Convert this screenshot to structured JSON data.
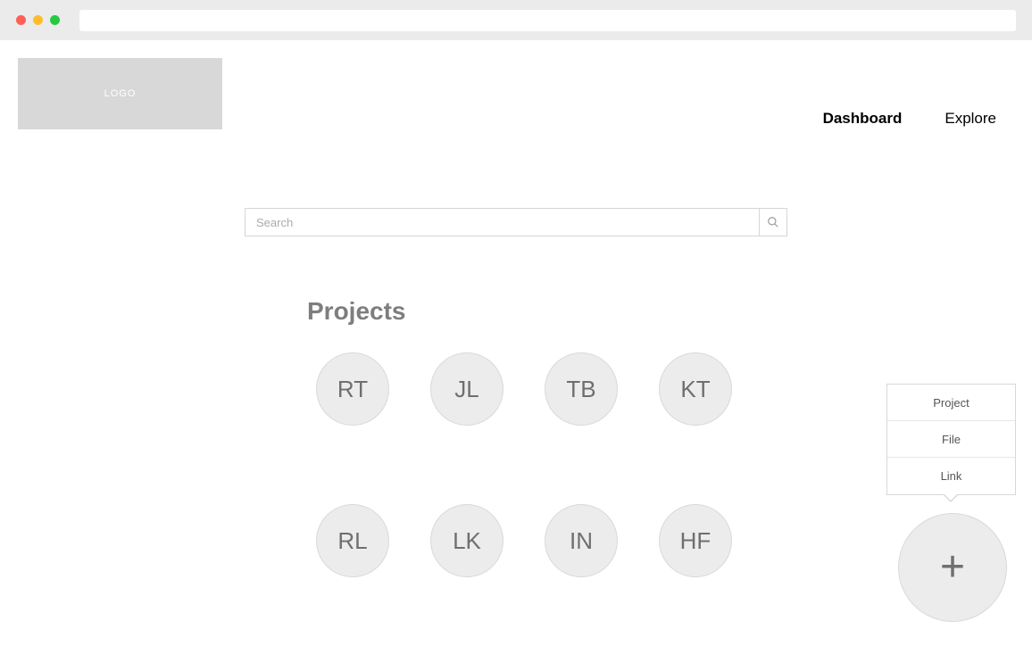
{
  "logo": {
    "label": "LOGO"
  },
  "nav": {
    "dashboard": "Dashboard",
    "explore": "Explore"
  },
  "search": {
    "placeholder": "Search"
  },
  "section": {
    "title": "Projects",
    "projects": [
      {
        "initials": "RT"
      },
      {
        "initials": "JL"
      },
      {
        "initials": "TB"
      },
      {
        "initials": "KT"
      },
      {
        "initials": "RL"
      },
      {
        "initials": "LK"
      },
      {
        "initials": "IN"
      },
      {
        "initials": "HF"
      }
    ]
  },
  "fab_menu": {
    "items": [
      {
        "label": "Project"
      },
      {
        "label": "File"
      },
      {
        "label": "Link"
      }
    ]
  }
}
